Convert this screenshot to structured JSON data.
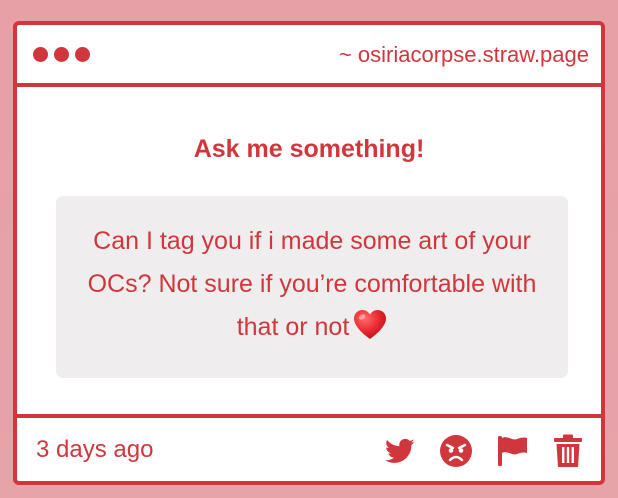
{
  "window": {
    "url": "~ osiriacorpse.straw.page"
  },
  "content": {
    "heading": "Ask me something!",
    "question": "Can I tag you if i made some art of your OCs? Not sure if you’re comfortable with that or not",
    "question_emoji": "red-heart-icon"
  },
  "footer": {
    "timestamp": "3 days ago",
    "actions": [
      "twitter-icon",
      "angry-face-icon",
      "flag-icon",
      "trash-icon"
    ]
  },
  "colors": {
    "accent": "#d0363c",
    "bubble": "#efedee",
    "page_background": "#e7a0a6"
  }
}
